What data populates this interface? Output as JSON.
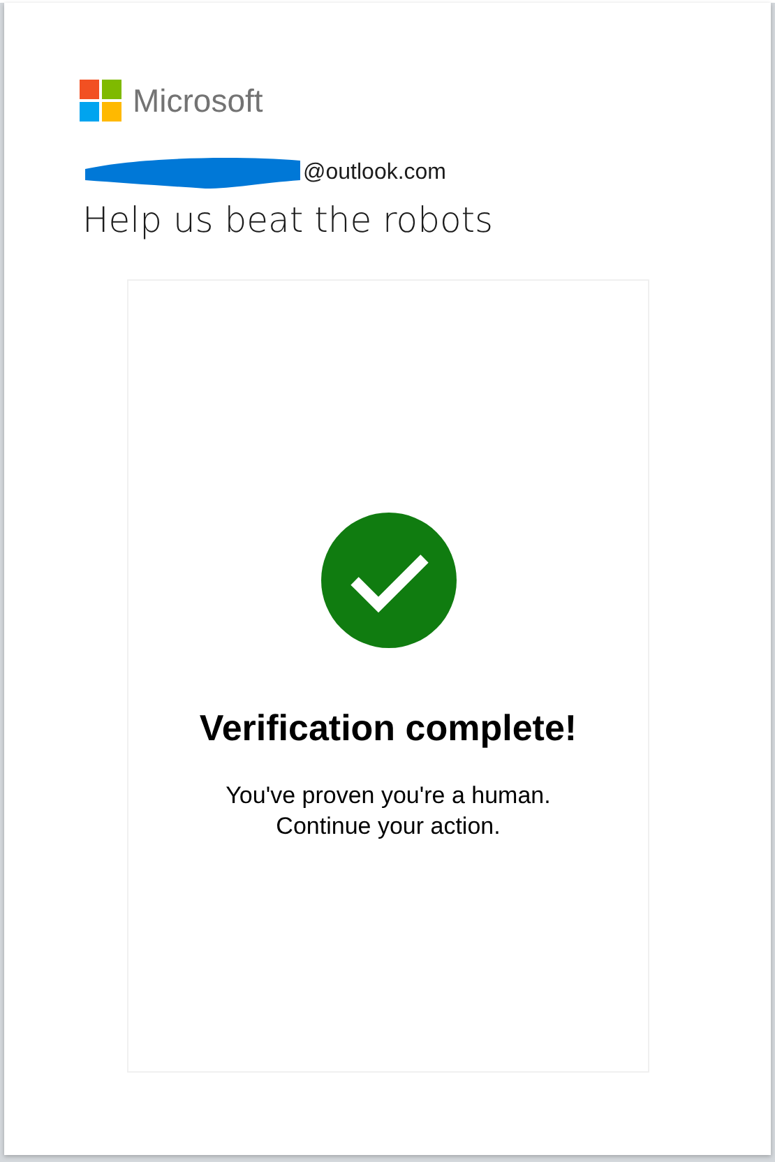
{
  "logo": {
    "text": "Microsoft"
  },
  "account": {
    "email_visible": "@outlook.com",
    "redacted": true
  },
  "heading": "Help us beat the robots",
  "verification": {
    "complete": true,
    "title": "Verification complete!",
    "lines": [
      "You've proven you're a human.",
      "Continue your action."
    ]
  }
}
